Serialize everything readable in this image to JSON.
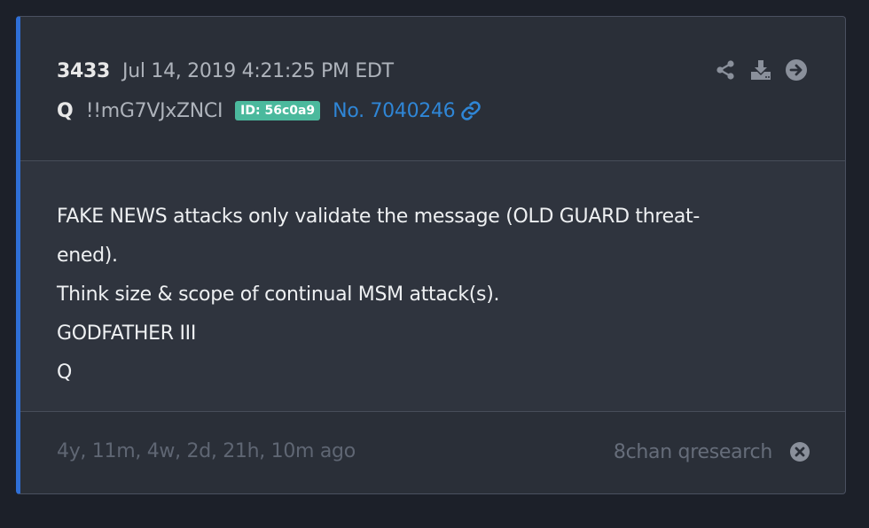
{
  "post": {
    "number": "3433",
    "date": "Jul 14, 2019 4:21:25 PM EDT",
    "author": "Q",
    "tripcode": "!!mG7VJxZNCI",
    "id_badge": "ID: 56c0a9",
    "post_link": "No. 7040246",
    "body_lines": [
      "FAKE NEWS attacks only validate the message (OLD GUARD threat-",
      "ened).",
      "Think size & scope of continual MSM attack(s).",
      "GODFATHER III",
      "Q"
    ],
    "time_ago": "4y, 11m, 4w, 2d, 21h, 10m ago",
    "source": "8chan qresearch"
  },
  "colors": {
    "background": "#1c2029",
    "card": "#2a2f38",
    "accent_border": "#2f6fd6",
    "link": "#2f86d6",
    "id_badge": "#4bb99d"
  },
  "icons": [
    "share-icon",
    "download-icon",
    "arrow-right-circle-icon",
    "link-icon",
    "close-circle-icon"
  ]
}
